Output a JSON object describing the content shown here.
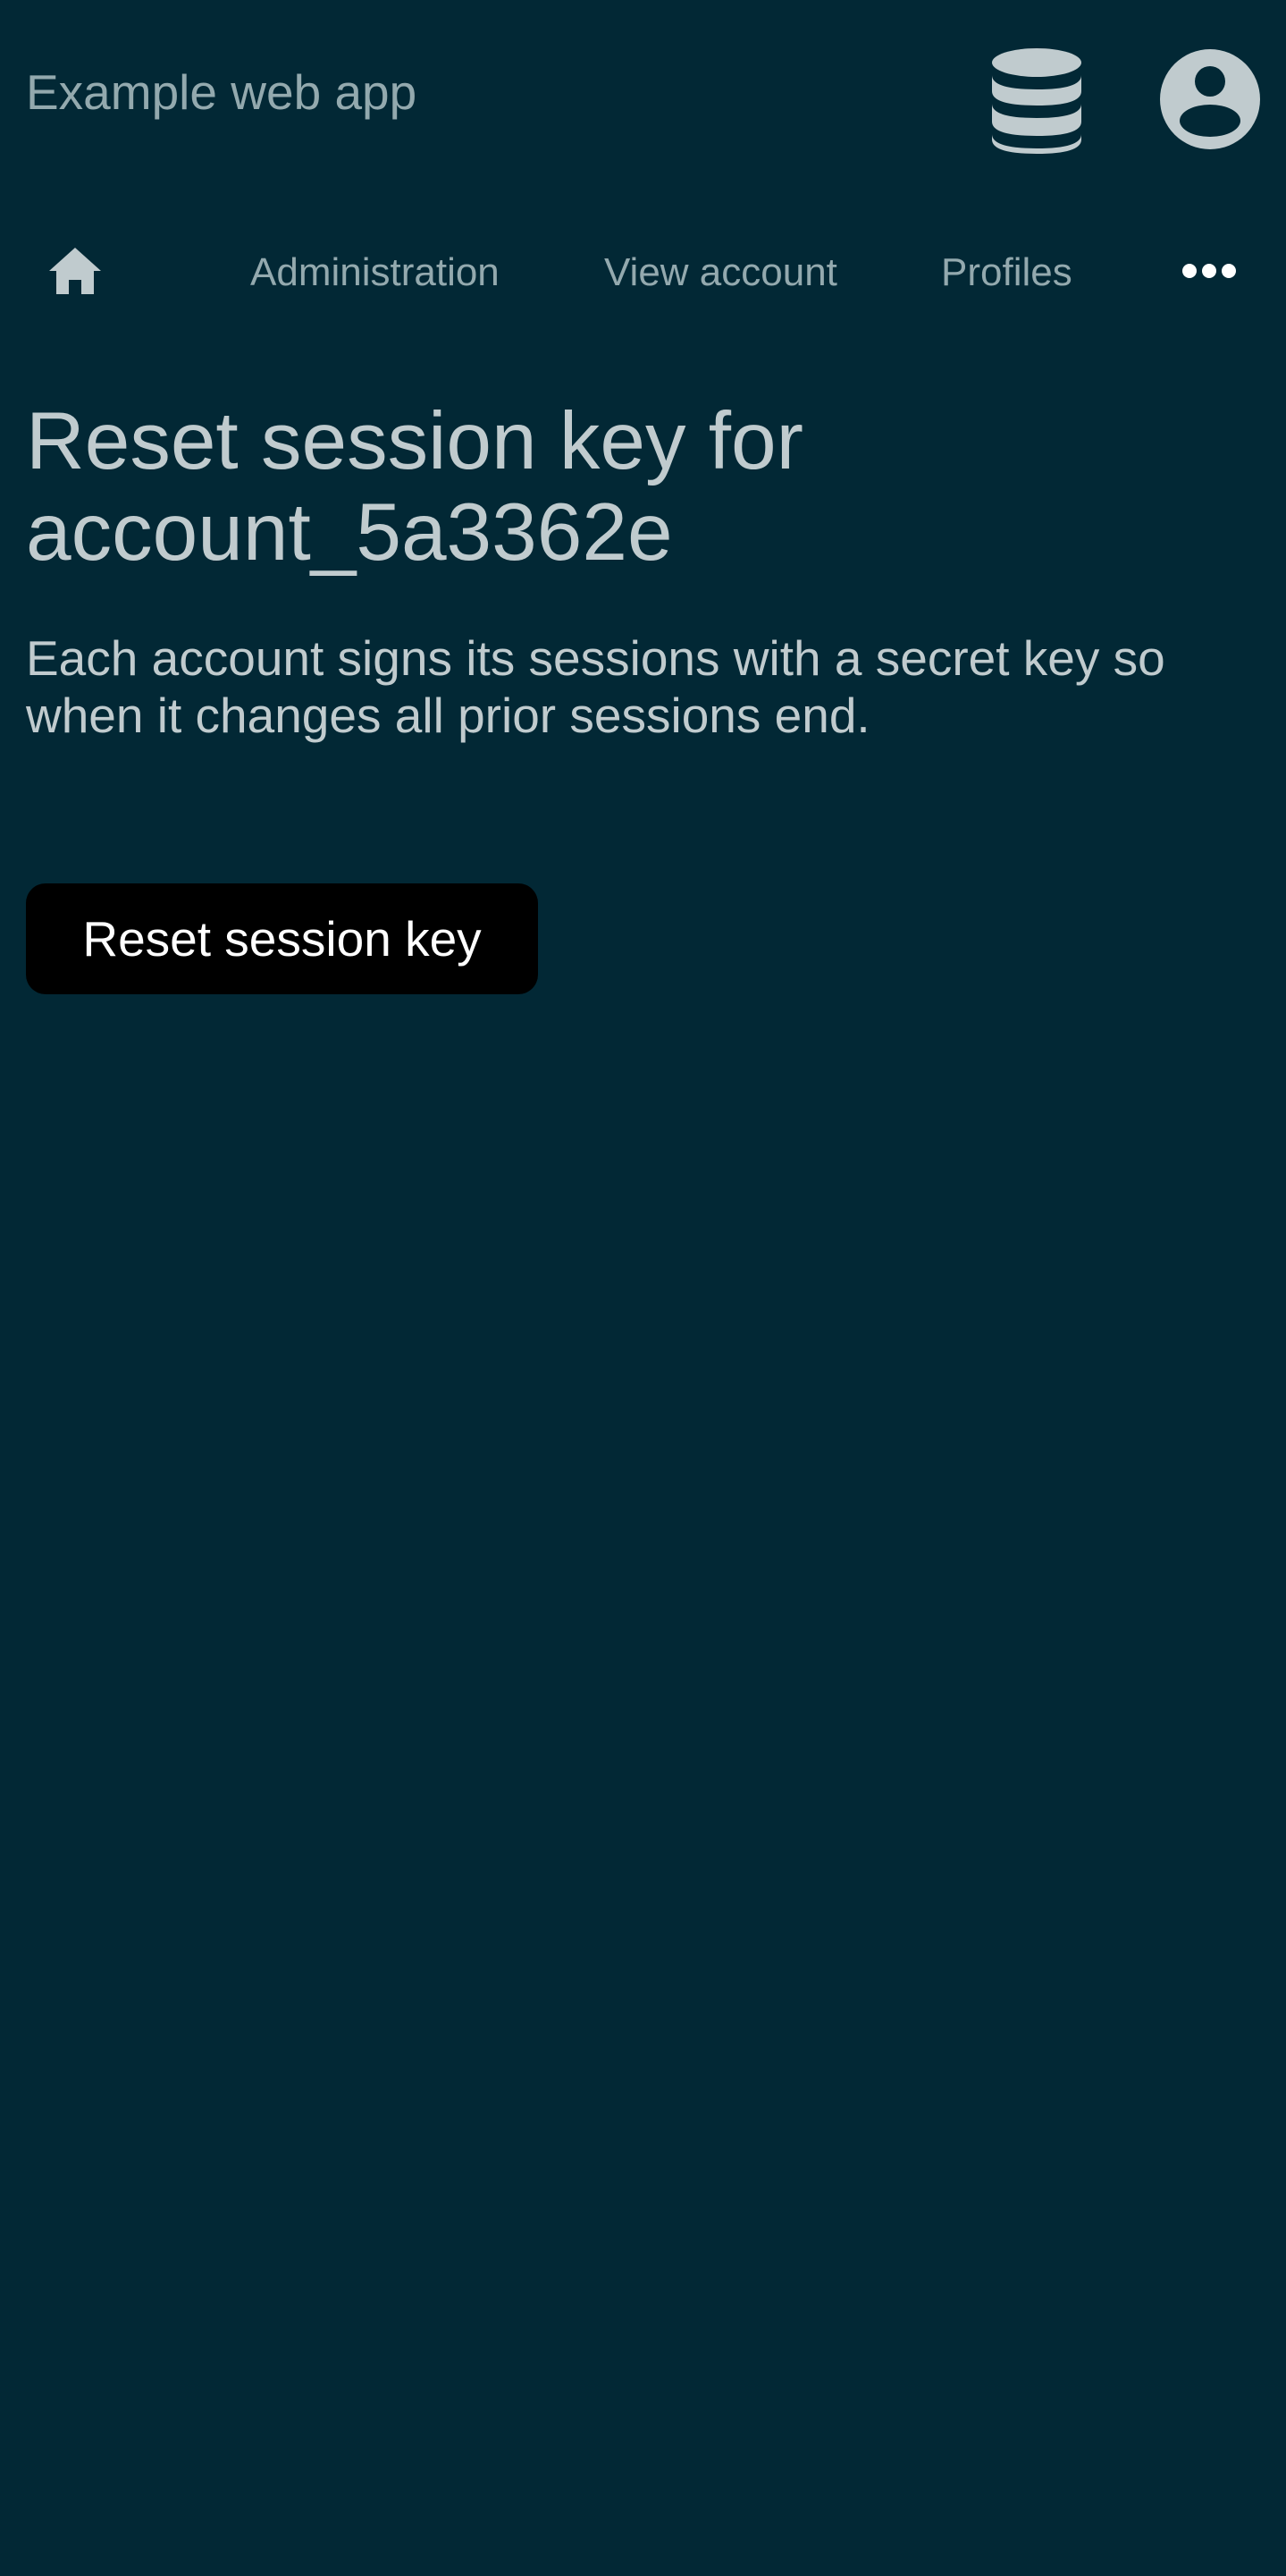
{
  "header": {
    "app_title": "Example web app",
    "db_icon": "database-icon",
    "account_icon": "account-circle-icon"
  },
  "nav": {
    "home_icon": "home-icon",
    "items": [
      {
        "label": "Administration"
      },
      {
        "label": "View account"
      },
      {
        "label": "Profiles"
      }
    ],
    "more_icon": "more-horizontal-icon"
  },
  "main": {
    "title": "Reset session key for account_5a3362e",
    "description": "Each account signs its sessions with a secret key so when it changes all prior sessions end.",
    "reset_button_label": "Reset session key"
  },
  "colors": {
    "background": "#022835",
    "muted_text": "#93a9ae",
    "text": "#c0cbce",
    "icon": "#c0cbce",
    "button_bg": "#000000",
    "button_text": "#ffffff"
  }
}
